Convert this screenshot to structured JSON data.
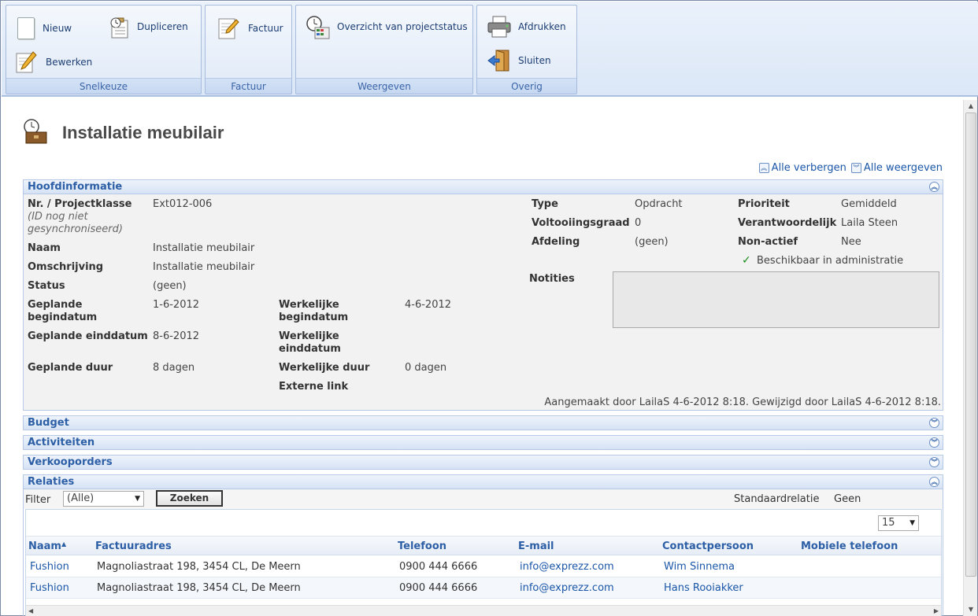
{
  "ribbon": {
    "groups": [
      {
        "label": "Snelkeuze",
        "buttons": [
          "Nieuw",
          "Dupliceren",
          "Bewerken"
        ]
      },
      {
        "label": "Factuur",
        "buttons": [
          "Factuur"
        ]
      },
      {
        "label": "Weergeven",
        "buttons": [
          "Overzicht van projectstatus"
        ]
      },
      {
        "label": "Overig",
        "buttons": [
          "Afdrukken",
          "Sluiten"
        ]
      }
    ]
  },
  "page": {
    "title": "Installatie meubilair",
    "hide_all": "Alle verbergen",
    "show_all": "Alle weergeven"
  },
  "sections": {
    "hoofdinformatie": "Hoofdinformatie",
    "budget": "Budget",
    "activiteiten": "Activiteiten",
    "verkooporders": "Verkooporders",
    "relaties": "Relaties"
  },
  "main": {
    "nr_label": "Nr. / Projectklasse",
    "nr_sub": "(ID nog niet gesynchroniseerd)",
    "nr_value": "Ext012-006",
    "naam_label": "Naam",
    "naam_value": "Installatie meubilair",
    "omschrijving_label": "Omschrijving",
    "omschrijving_value": "Installatie meubilair",
    "status_label": "Status",
    "status_value": "(geen)",
    "gepl_begin_label": "Geplande begindatum",
    "gepl_begin_value": "1-6-2012",
    "gepl_eind_label": "Geplande einddatum",
    "gepl_eind_value": "8-6-2012",
    "gepl_duur_label": "Geplande duur",
    "gepl_duur_value": "8 dagen",
    "werk_begin_label": "Werkelijke begindatum",
    "werk_begin_value": "4-6-2012",
    "werk_eind_label": "Werkelijke einddatum",
    "werk_eind_value": "",
    "werk_duur_label": "Werkelijke duur",
    "werk_duur_value": "0 dagen",
    "externe_link_label": "Externe link",
    "type_label": "Type",
    "type_value": "Opdracht",
    "voltooiing_label": "Voltooiingsgraad",
    "voltooiing_value": "0",
    "afdeling_label": "Afdeling",
    "afdeling_value": "(geen)",
    "prioriteit_label": "Prioriteit",
    "prioriteit_value": "Gemiddeld",
    "verantwoordelijk_label": "Verantwoordelijk",
    "verantwoordelijk_value": "Laila Steen",
    "nonactief_label": "Non-actief",
    "nonactief_value": "Nee",
    "beschikbaar_label": "Beschikbaar in administratie",
    "notities_label": "Notities",
    "audit": "Aangemaakt door LailaS 4-6-2012 8:18. Gewijzigd door LailaS 4-6-2012 8:18."
  },
  "relaties": {
    "filter_label": "Filter",
    "filter_value": "(Alle)",
    "search_button": "Zoeken",
    "standaard_label": "Standaardrelatie",
    "standaard_value": "Geen",
    "page_size": "15",
    "columns": [
      "Naam",
      "Factuuradres",
      "Telefoon",
      "E-mail",
      "Contactpersoon",
      "Mobiele telefoon"
    ],
    "rows": [
      {
        "naam": "Fushion",
        "adres": "Magnoliastraat 198, 3454 CL, De Meern",
        "telefoon": "0900 444 6666",
        "email": "info@exprezz.com",
        "contact": "Wim Sinnema",
        "mobiel": ""
      },
      {
        "naam": "Fushion",
        "adres": "Magnoliastraat 198, 3454 CL, De Meern",
        "telefoon": "0900 444 6666",
        "email": "info@exprezz.com",
        "contact": "Hans Rooiakker",
        "mobiel": ""
      }
    ]
  }
}
